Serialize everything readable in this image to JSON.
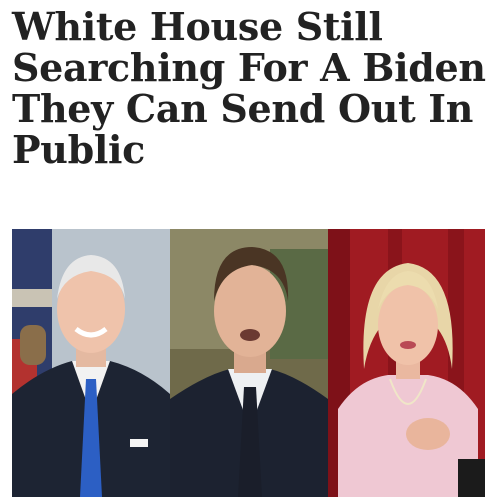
{
  "article": {
    "headline_lines": [
      "White House Still",
      "Searching For A Biden",
      "They Can Send Out In",
      "Public"
    ]
  },
  "photos": [
    {
      "subject": "older man in dark suit with blue tie, white hair, smiling, flag backdrop"
    },
    {
      "subject": "man in dark suit with dark tie, brown hair, speaking"
    },
    {
      "subject": "woman with blonde hair in light pink outfit, red curtain backdrop"
    }
  ],
  "colors": {
    "headline_text": "#222222",
    "background": "#ffffff"
  }
}
